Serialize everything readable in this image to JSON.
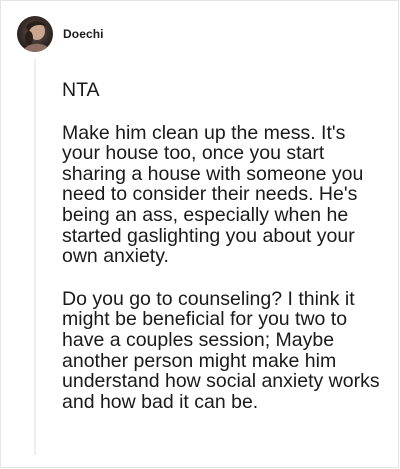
{
  "comment": {
    "author": "Doechi",
    "avatar_icon": "user-avatar-photo",
    "paragraphs": [
      "NTA",
      "Make him clean up the mess. It's your house too, once you start sharing a house with someone you need to consider their needs. He's being an ass, especially when he started gaslighting you about your own anxiety.",
      "Do you go to counseling? I think it might be beneficial for you two to have a couples session; Maybe another person might make him understand how social anxiety works and how bad it can be."
    ]
  }
}
